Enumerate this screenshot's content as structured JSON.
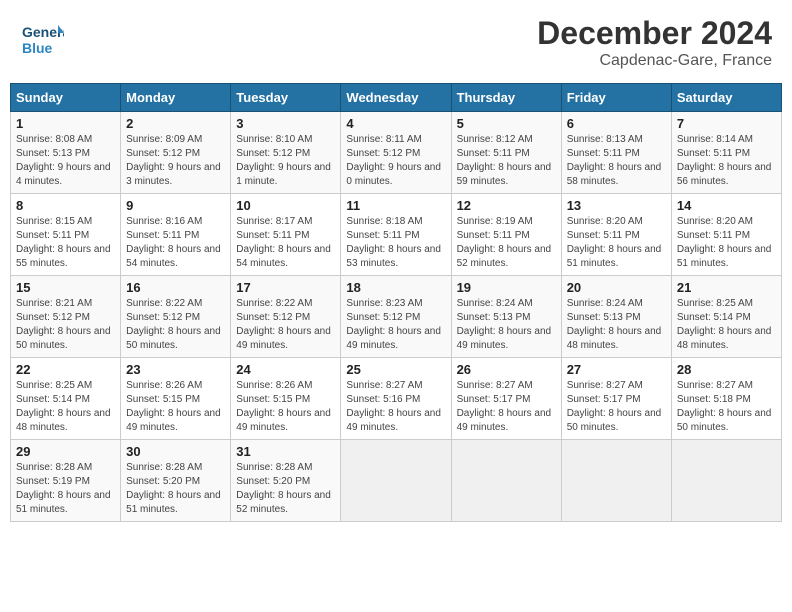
{
  "header": {
    "logo_text_general": "General",
    "logo_text_blue": "Blue",
    "title": "December 2024",
    "subtitle": "Capdenac-Gare, France"
  },
  "calendar": {
    "weekdays": [
      "Sunday",
      "Monday",
      "Tuesday",
      "Wednesday",
      "Thursday",
      "Friday",
      "Saturday"
    ],
    "weeks": [
      [
        {
          "day": "1",
          "info": "Sunrise: 8:08 AM\nSunset: 5:13 PM\nDaylight: 9 hours and 4 minutes."
        },
        {
          "day": "2",
          "info": "Sunrise: 8:09 AM\nSunset: 5:12 PM\nDaylight: 9 hours and 3 minutes."
        },
        {
          "day": "3",
          "info": "Sunrise: 8:10 AM\nSunset: 5:12 PM\nDaylight: 9 hours and 1 minute."
        },
        {
          "day": "4",
          "info": "Sunrise: 8:11 AM\nSunset: 5:12 PM\nDaylight: 9 hours and 0 minutes."
        },
        {
          "day": "5",
          "info": "Sunrise: 8:12 AM\nSunset: 5:11 PM\nDaylight: 8 hours and 59 minutes."
        },
        {
          "day": "6",
          "info": "Sunrise: 8:13 AM\nSunset: 5:11 PM\nDaylight: 8 hours and 58 minutes."
        },
        {
          "day": "7",
          "info": "Sunrise: 8:14 AM\nSunset: 5:11 PM\nDaylight: 8 hours and 56 minutes."
        }
      ],
      [
        {
          "day": "8",
          "info": "Sunrise: 8:15 AM\nSunset: 5:11 PM\nDaylight: 8 hours and 55 minutes."
        },
        {
          "day": "9",
          "info": "Sunrise: 8:16 AM\nSunset: 5:11 PM\nDaylight: 8 hours and 54 minutes."
        },
        {
          "day": "10",
          "info": "Sunrise: 8:17 AM\nSunset: 5:11 PM\nDaylight: 8 hours and 54 minutes."
        },
        {
          "day": "11",
          "info": "Sunrise: 8:18 AM\nSunset: 5:11 PM\nDaylight: 8 hours and 53 minutes."
        },
        {
          "day": "12",
          "info": "Sunrise: 8:19 AM\nSunset: 5:11 PM\nDaylight: 8 hours and 52 minutes."
        },
        {
          "day": "13",
          "info": "Sunrise: 8:20 AM\nSunset: 5:11 PM\nDaylight: 8 hours and 51 minutes."
        },
        {
          "day": "14",
          "info": "Sunrise: 8:20 AM\nSunset: 5:11 PM\nDaylight: 8 hours and 51 minutes."
        }
      ],
      [
        {
          "day": "15",
          "info": "Sunrise: 8:21 AM\nSunset: 5:12 PM\nDaylight: 8 hours and 50 minutes."
        },
        {
          "day": "16",
          "info": "Sunrise: 8:22 AM\nSunset: 5:12 PM\nDaylight: 8 hours and 50 minutes."
        },
        {
          "day": "17",
          "info": "Sunrise: 8:22 AM\nSunset: 5:12 PM\nDaylight: 8 hours and 49 minutes."
        },
        {
          "day": "18",
          "info": "Sunrise: 8:23 AM\nSunset: 5:12 PM\nDaylight: 8 hours and 49 minutes."
        },
        {
          "day": "19",
          "info": "Sunrise: 8:24 AM\nSunset: 5:13 PM\nDaylight: 8 hours and 49 minutes."
        },
        {
          "day": "20",
          "info": "Sunrise: 8:24 AM\nSunset: 5:13 PM\nDaylight: 8 hours and 48 minutes."
        },
        {
          "day": "21",
          "info": "Sunrise: 8:25 AM\nSunset: 5:14 PM\nDaylight: 8 hours and 48 minutes."
        }
      ],
      [
        {
          "day": "22",
          "info": "Sunrise: 8:25 AM\nSunset: 5:14 PM\nDaylight: 8 hours and 48 minutes."
        },
        {
          "day": "23",
          "info": "Sunrise: 8:26 AM\nSunset: 5:15 PM\nDaylight: 8 hours and 49 minutes."
        },
        {
          "day": "24",
          "info": "Sunrise: 8:26 AM\nSunset: 5:15 PM\nDaylight: 8 hours and 49 minutes."
        },
        {
          "day": "25",
          "info": "Sunrise: 8:27 AM\nSunset: 5:16 PM\nDaylight: 8 hours and 49 minutes."
        },
        {
          "day": "26",
          "info": "Sunrise: 8:27 AM\nSunset: 5:17 PM\nDaylight: 8 hours and 49 minutes."
        },
        {
          "day": "27",
          "info": "Sunrise: 8:27 AM\nSunset: 5:17 PM\nDaylight: 8 hours and 50 minutes."
        },
        {
          "day": "28",
          "info": "Sunrise: 8:27 AM\nSunset: 5:18 PM\nDaylight: 8 hours and 50 minutes."
        }
      ],
      [
        {
          "day": "29",
          "info": "Sunrise: 8:28 AM\nSunset: 5:19 PM\nDaylight: 8 hours and 51 minutes."
        },
        {
          "day": "30",
          "info": "Sunrise: 8:28 AM\nSunset: 5:20 PM\nDaylight: 8 hours and 51 minutes."
        },
        {
          "day": "31",
          "info": "Sunrise: 8:28 AM\nSunset: 5:20 PM\nDaylight: 8 hours and 52 minutes."
        },
        {
          "day": "",
          "info": ""
        },
        {
          "day": "",
          "info": ""
        },
        {
          "day": "",
          "info": ""
        },
        {
          "day": "",
          "info": ""
        }
      ]
    ]
  }
}
